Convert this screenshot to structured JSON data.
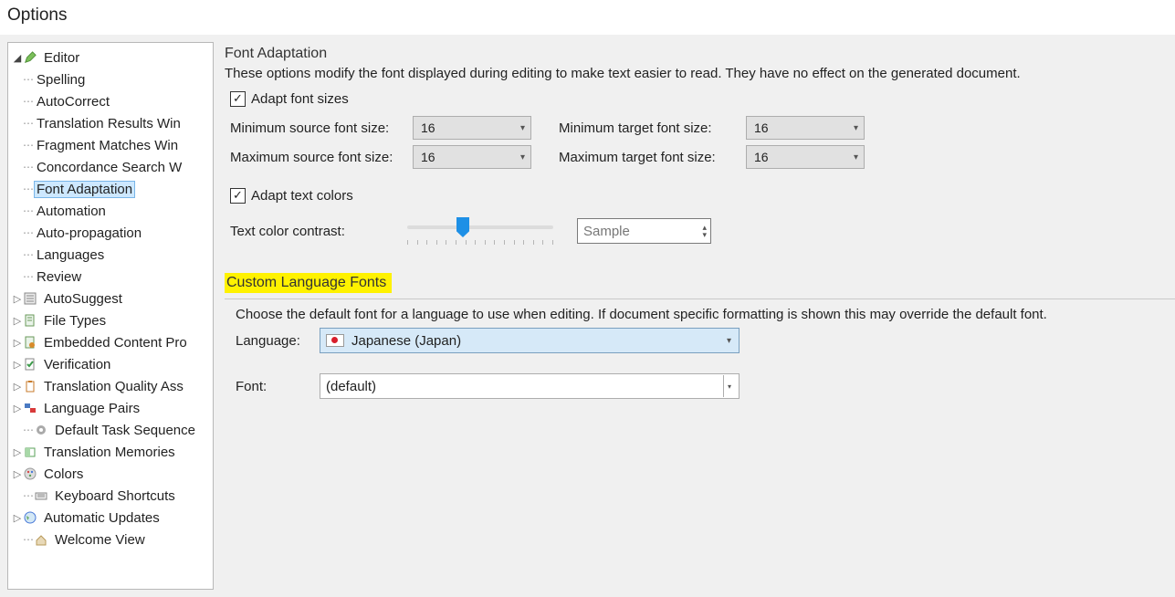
{
  "window": {
    "title": "Options"
  },
  "tree": {
    "editor": {
      "label": "Editor",
      "children": {
        "spelling": "Spelling",
        "autocorrect": "AutoCorrect",
        "trw": "Translation Results Win",
        "fmw": "Fragment Matches Win",
        "csw": "Concordance Search W",
        "fontadapt": "Font Adaptation",
        "automation": "Automation",
        "autoprop": "Auto-propagation",
        "languages": "Languages",
        "review": "Review"
      }
    },
    "top": {
      "autosuggest": "AutoSuggest",
      "filetypes": "File Types",
      "embedded": "Embedded Content Pro",
      "verification": "Verification",
      "tqa": "Translation Quality Ass",
      "langpairs": "Language Pairs",
      "defaulttask": "Default Task Sequence",
      "tm": "Translation Memories",
      "colors": "Colors",
      "keyboard": "Keyboard Shortcuts",
      "updates": "Automatic Updates",
      "welcome": "Welcome View"
    }
  },
  "fontAdaptation": {
    "title": "Font Adaptation",
    "desc": "These options modify the font displayed during editing to make text easier to read. They have no effect on the generated document.",
    "adaptSizesLabel": "Adapt font sizes",
    "minSrcLabel": "Minimum source font size:",
    "minSrcValue": "16",
    "minTgtLabel": "Minimum target font size:",
    "minTgtValue": "16",
    "maxSrcLabel": "Maximum source font size:",
    "maxSrcValue": "16",
    "maxTgtLabel": "Maximum target font size:",
    "maxTgtValue": "16",
    "adaptColorsLabel": "Adapt text colors",
    "contrastLabel": "Text color contrast:",
    "sample": "Sample"
  },
  "customFonts": {
    "title": "Custom Language Fonts",
    "desc": "Choose the default font for a language to use when editing. If document specific formatting is shown this may override the default font.",
    "languageLabel": "Language:",
    "languageValue": "Japanese (Japan)",
    "fontLabel": "Font:",
    "fontValue": "(default)"
  }
}
